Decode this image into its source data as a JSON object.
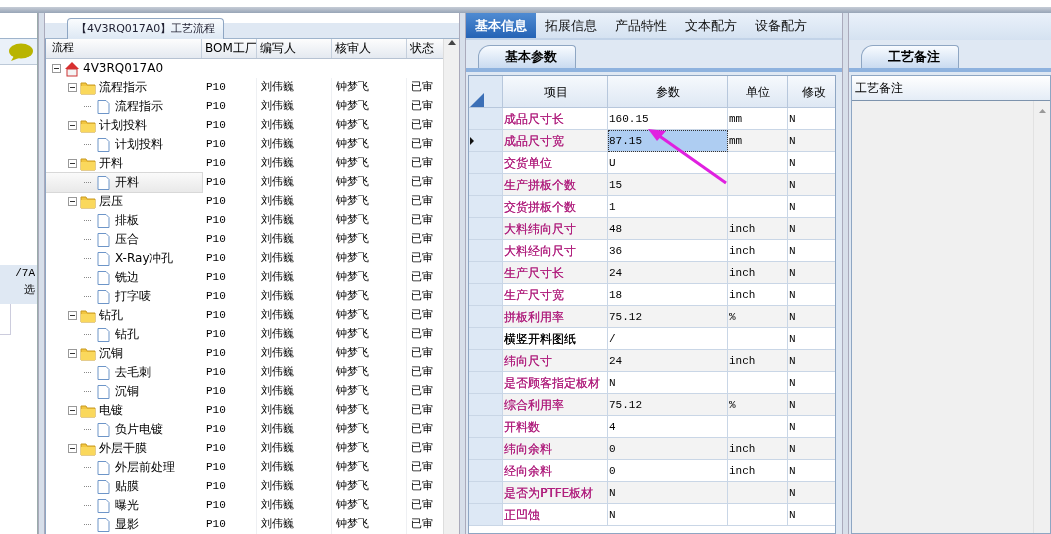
{
  "left_panel": {
    "cut_labels": [
      "/7A",
      "选"
    ]
  },
  "process_panel": {
    "title": "【4V3RQ017A0】工艺流程",
    "columns": [
      "流程",
      "BOM工厂",
      "编写人",
      "核审人",
      "状态"
    ],
    "tree": [
      {
        "label": "4V3RQ017A0",
        "kind": "root",
        "expanded": true,
        "children": [
          {
            "label": "流程指示",
            "kind": "folder",
            "expanded": true,
            "cells": [
              "P10",
              "刘伟巍",
              "钟梦飞",
              "已审"
            ],
            "children": [
              {
                "label": "流程指示",
                "kind": "page",
                "selected": false,
                "cells": [
                  "P10",
                  "刘伟巍",
                  "钟梦飞",
                  "已审"
                ]
              }
            ]
          },
          {
            "label": "计划投料",
            "kind": "folder",
            "expanded": true,
            "cells": [
              "P10",
              "刘伟巍",
              "钟梦飞",
              "已审"
            ],
            "children": [
              {
                "label": "计划投料",
                "kind": "page",
                "selected": false,
                "cells": [
                  "P10",
                  "刘伟巍",
                  "钟梦飞",
                  "已审"
                ]
              }
            ]
          },
          {
            "label": "开料",
            "kind": "folder",
            "expanded": true,
            "cells": [
              "P10",
              "刘伟巍",
              "钟梦飞",
              "已审"
            ],
            "children": [
              {
                "label": "开料",
                "kind": "page",
                "selected": true,
                "cells": [
                  "P10",
                  "刘伟巍",
                  "钟梦飞",
                  "已审"
                ]
              }
            ]
          },
          {
            "label": "层压",
            "kind": "folder",
            "expanded": true,
            "cells": [
              "P10",
              "刘伟巍",
              "钟梦飞",
              "已审"
            ],
            "children": [
              {
                "label": "排板",
                "kind": "page",
                "selected": false,
                "cells": [
                  "P10",
                  "刘伟巍",
                  "钟梦飞",
                  "已审"
                ]
              },
              {
                "label": "压合",
                "kind": "page",
                "selected": false,
                "cells": [
                  "P10",
                  "刘伟巍",
                  "钟梦飞",
                  "已审"
                ]
              },
              {
                "label": "X-Ray冲孔",
                "kind": "page",
                "selected": false,
                "cells": [
                  "P10",
                  "刘伟巍",
                  "钟梦飞",
                  "已审"
                ]
              },
              {
                "label": "铣边",
                "kind": "page",
                "selected": false,
                "cells": [
                  "P10",
                  "刘伟巍",
                  "钟梦飞",
                  "已审"
                ]
              },
              {
                "label": "打字唛",
                "kind": "page",
                "selected": false,
                "cells": [
                  "P10",
                  "刘伟巍",
                  "钟梦飞",
                  "已审"
                ]
              }
            ]
          },
          {
            "label": "钻孔",
            "kind": "folder",
            "expanded": true,
            "cells": [
              "P10",
              "刘伟巍",
              "钟梦飞",
              "已审"
            ],
            "children": [
              {
                "label": "钻孔",
                "kind": "page",
                "selected": false,
                "cells": [
                  "P10",
                  "刘伟巍",
                  "钟梦飞",
                  "已审"
                ]
              }
            ]
          },
          {
            "label": "沉铜",
            "kind": "folder",
            "expanded": true,
            "cells": [
              "P10",
              "刘伟巍",
              "钟梦飞",
              "已审"
            ],
            "children": [
              {
                "label": "去毛刺",
                "kind": "page",
                "selected": false,
                "cells": [
                  "P10",
                  "刘伟巍",
                  "钟梦飞",
                  "已审"
                ]
              },
              {
                "label": "沉铜",
                "kind": "page",
                "selected": false,
                "cells": [
                  "P10",
                  "刘伟巍",
                  "钟梦飞",
                  "已审"
                ]
              }
            ]
          },
          {
            "label": "电镀",
            "kind": "folder",
            "expanded": true,
            "cells": [
              "P10",
              "刘伟巍",
              "钟梦飞",
              "已审"
            ],
            "children": [
              {
                "label": "负片电镀",
                "kind": "page",
                "selected": false,
                "cells": [
                  "P10",
                  "刘伟巍",
                  "钟梦飞",
                  "已审"
                ]
              }
            ]
          },
          {
            "label": "外层干膜",
            "kind": "folder",
            "expanded": true,
            "cells": [
              "P10",
              "刘伟巍",
              "钟梦飞",
              "已审"
            ],
            "children": [
              {
                "label": "外层前处理",
                "kind": "page",
                "selected": false,
                "cells": [
                  "P10",
                  "刘伟巍",
                  "钟梦飞",
                  "已审"
                ]
              },
              {
                "label": "贴膜",
                "kind": "page",
                "selected": false,
                "cells": [
                  "P10",
                  "刘伟巍",
                  "钟梦飞",
                  "已审"
                ]
              },
              {
                "label": "曝光",
                "kind": "page",
                "selected": false,
                "cells": [
                  "P10",
                  "刘伟巍",
                  "钟梦飞",
                  "已审"
                ]
              },
              {
                "label": "显影",
                "kind": "page",
                "selected": false,
                "cells": [
                  "P10",
                  "刘伟巍",
                  "钟梦飞",
                  "已审"
                ]
              }
            ]
          }
        ]
      }
    ]
  },
  "tabs": [
    {
      "label": "基本信息",
      "selected": true
    },
    {
      "label": "拓展信息",
      "selected": false
    },
    {
      "label": "产品特性",
      "selected": false
    },
    {
      "label": "文本配方",
      "selected": false
    },
    {
      "label": "设备配方",
      "selected": false
    }
  ],
  "params_panel": {
    "tab": "基本参数",
    "columns": [
      "项目",
      "参数",
      "单位",
      "修改"
    ],
    "rows": [
      {
        "item": "成品尺寸长",
        "value": "160.15",
        "unit": "mm",
        "modified": "N",
        "color": "#b0207e",
        "selected": false
      },
      {
        "item": "成品尺寸宽",
        "value": "87.15",
        "unit": "mm",
        "modified": "N",
        "color": "#b0207e",
        "selected": true
      },
      {
        "item": "交货单位",
        "value": "U",
        "unit": "",
        "modified": "N",
        "color": "#b0207e",
        "selected": false
      },
      {
        "item": "生产拼板个数",
        "value": "15",
        "unit": "",
        "modified": "N",
        "color": "#b0207e",
        "selected": false
      },
      {
        "item": "交货拼板个数",
        "value": "1",
        "unit": "",
        "modified": "N",
        "color": "#b0207e",
        "selected": false
      },
      {
        "item": "大料纬向尺寸",
        "value": "48",
        "unit": "inch",
        "modified": "N",
        "color": "#b0207e",
        "selected": false
      },
      {
        "item": "大料经向尺寸",
        "value": "36",
        "unit": "inch",
        "modified": "N",
        "color": "#b0207e",
        "selected": false
      },
      {
        "item": "生产尺寸长",
        "value": "24",
        "unit": "inch",
        "modified": "N",
        "color": "#b0207e",
        "selected": false
      },
      {
        "item": "生产尺寸宽",
        "value": "18",
        "unit": "inch",
        "modified": "N",
        "color": "#b0207e",
        "selected": false
      },
      {
        "item": "拼板利用率",
        "value": "75.12",
        "unit": "%",
        "modified": "N",
        "color": "#b0207e",
        "selected": false
      },
      {
        "item": "横竖开料图纸",
        "value": "/",
        "unit": "",
        "modified": "N",
        "color": "#000000",
        "selected": false
      },
      {
        "item": "纬向尺寸",
        "value": "24",
        "unit": "inch",
        "modified": "N",
        "color": "#b0207e",
        "selected": false
      },
      {
        "item": "是否顾客指定板材",
        "value": "N",
        "unit": "",
        "modified": "N",
        "color": "#b0207e",
        "selected": false
      },
      {
        "item": "综合利用率",
        "value": "75.12",
        "unit": "%",
        "modified": "N",
        "color": "#b0207e",
        "selected": false
      },
      {
        "item": "开料数",
        "value": "4",
        "unit": "",
        "modified": "N",
        "color": "#b0207e",
        "selected": false
      },
      {
        "item": "纬向余料",
        "value": "0",
        "unit": "inch",
        "modified": "N",
        "color": "#b0207e",
        "selected": false
      },
      {
        "item": "经向余料",
        "value": "0",
        "unit": "inch",
        "modified": "N",
        "color": "#b0207e",
        "selected": false
      },
      {
        "item": "是否为PTFE板材",
        "value": "N",
        "unit": "",
        "modified": "N",
        "color": "#b0207e",
        "selected": false
      },
      {
        "item": "正凹蚀",
        "value": "N",
        "unit": "",
        "modified": "N",
        "color": "#b0207e",
        "selected": false
      }
    ]
  },
  "notes_panel": {
    "tab": "工艺备注",
    "header": "工艺备注"
  }
}
